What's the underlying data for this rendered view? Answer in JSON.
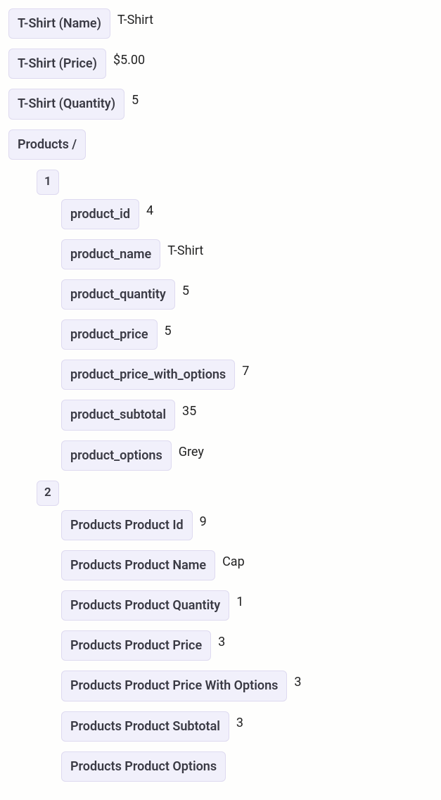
{
  "top": [
    {
      "label": "T-Shirt (Name)",
      "value": "T-Shirt"
    },
    {
      "label": "T-Shirt (Price)",
      "value": "$5.00"
    },
    {
      "label": "T-Shirt (Quantity)",
      "value": "5"
    }
  ],
  "productsHeader": "Products /",
  "products": [
    {
      "index": "1",
      "fields": [
        {
          "label": "product_id",
          "value": "4"
        },
        {
          "label": "product_name",
          "value": "T-Shirt"
        },
        {
          "label": "product_quantity",
          "value": "5"
        },
        {
          "label": "product_price",
          "value": "5"
        },
        {
          "label": "product_price_with_options",
          "value": "7"
        },
        {
          "label": "product_subtotal",
          "value": "35"
        },
        {
          "label": "product_options",
          "value": "Grey"
        }
      ]
    },
    {
      "index": "2",
      "fields": [
        {
          "label": "Products Product Id",
          "value": "9"
        },
        {
          "label": "Products Product Name",
          "value": "Cap"
        },
        {
          "label": "Products Product Quantity",
          "value": "1"
        },
        {
          "label": "Products Product Price",
          "value": "3"
        },
        {
          "label": "Products Product Price With Options",
          "value": "3"
        },
        {
          "label": "Products Product Subtotal",
          "value": "3"
        },
        {
          "label": "Products Product Options",
          "value": ""
        }
      ]
    }
  ]
}
